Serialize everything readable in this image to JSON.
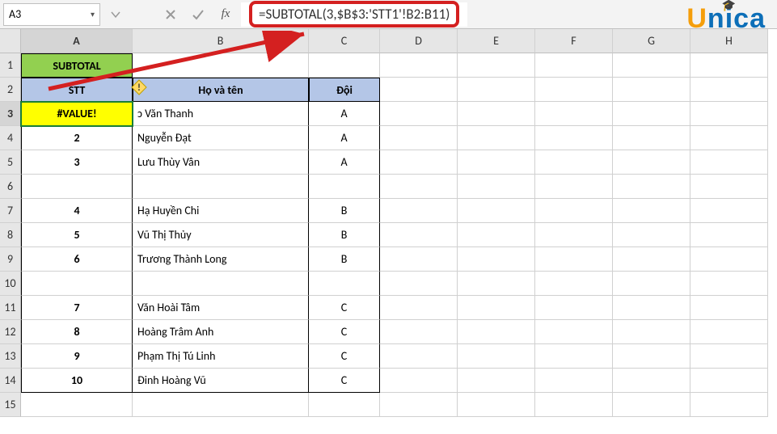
{
  "name_box": "A3",
  "formula": "=SUBTOTAL(3,$B$3:'STT1'!B2:B11)",
  "columns": [
    "A",
    "B",
    "C",
    "D",
    "E",
    "F",
    "G",
    "H"
  ],
  "rows": [
    "1",
    "2",
    "3",
    "4",
    "5",
    "6",
    "7",
    "8",
    "9",
    "10",
    "11",
    "12",
    "13",
    "14",
    "15"
  ],
  "header_a1": "SUBTOTAL",
  "header_a2": "STT",
  "header_b2": "Họ và tên",
  "header_c2": "Đội",
  "active_value": "#VALUE!",
  "data": [
    {
      "stt": "#VALUE!",
      "name": "ɔ Văn Thanh",
      "team": "A"
    },
    {
      "stt": "2",
      "name": "Nguyễn Đạt",
      "team": "A"
    },
    {
      "stt": "3",
      "name": "Lưu Thùy Vân",
      "team": "A"
    },
    {
      "stt": "",
      "name": "",
      "team": ""
    },
    {
      "stt": "4",
      "name": "Hạ Huyền Chi",
      "team": "B"
    },
    {
      "stt": "5",
      "name": "Vũ Thị Thủy",
      "team": "B"
    },
    {
      "stt": "6",
      "name": "Trương Thành Long",
      "team": "B"
    },
    {
      "stt": "",
      "name": "",
      "team": ""
    },
    {
      "stt": "7",
      "name": "Văn Hoài Tâm",
      "team": "C"
    },
    {
      "stt": "8",
      "name": "Hoàng Trâm Anh",
      "team": "C"
    },
    {
      "stt": "9",
      "name": "Phạm Thị Tú Linh",
      "team": "C"
    },
    {
      "stt": "10",
      "name": "Đinh Hoàng Vũ",
      "team": "C"
    }
  ],
  "logo": {
    "u": "U",
    "n": "n",
    "i": "i",
    "c": "c",
    "a": "a"
  },
  "chart_data": {
    "type": "table",
    "title": "SUBTOTAL",
    "columns": [
      "STT",
      "Họ và tên",
      "Đội"
    ],
    "rows": [
      [
        "#VALUE!",
        "ɔ Văn Thanh",
        "A"
      ],
      [
        "2",
        "Nguyễn Đạt",
        "A"
      ],
      [
        "3",
        "Lưu Thùy Vân",
        "A"
      ],
      [
        "",
        "",
        ""
      ],
      [
        "4",
        "Hạ Huyền Chi",
        "B"
      ],
      [
        "5",
        "Vũ Thị Thủy",
        "B"
      ],
      [
        "6",
        "Trương Thành Long",
        "B"
      ],
      [
        "",
        "",
        ""
      ],
      [
        "7",
        "Văn Hoài Tâm",
        "C"
      ],
      [
        "8",
        "Hoàng Trâm Anh",
        "C"
      ],
      [
        "9",
        "Phạm Thị Tú Linh",
        "C"
      ],
      [
        "10",
        "Đinh Hoàng Vũ",
        "C"
      ]
    ]
  }
}
